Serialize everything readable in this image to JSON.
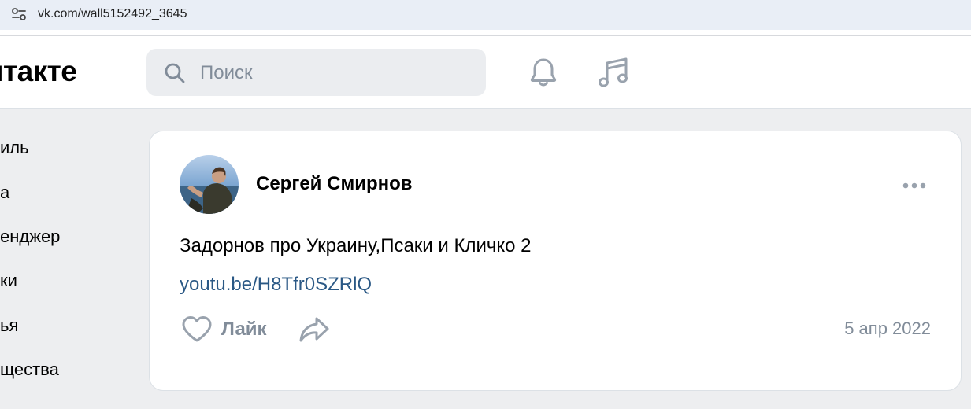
{
  "browser": {
    "url": "vk.com/wall5152492_3645"
  },
  "header": {
    "logo_text": "онтакте",
    "search_placeholder": "Поиск",
    "bell_icon": "bell-icon",
    "music_icon": "music-icon"
  },
  "sidenav": {
    "items": [
      {
        "label": "иль"
      },
      {
        "label": "а"
      },
      {
        "label": "енджер"
      },
      {
        "label": "ки"
      },
      {
        "label": "ья"
      },
      {
        "label": "щества"
      }
    ]
  },
  "post": {
    "author": "Сергей Смирнов",
    "text": "Задорнов про Украину,Псаки и Кличко 2",
    "link": "youtu.be/H8Tfr0SZRlQ",
    "like_label": "Лайк",
    "date": "5 апр 2022"
  },
  "colors": {
    "page_bg": "#edeef0",
    "link": "#2a5885",
    "secondary_text": "#818c99",
    "icon": "#99a2ad"
  }
}
